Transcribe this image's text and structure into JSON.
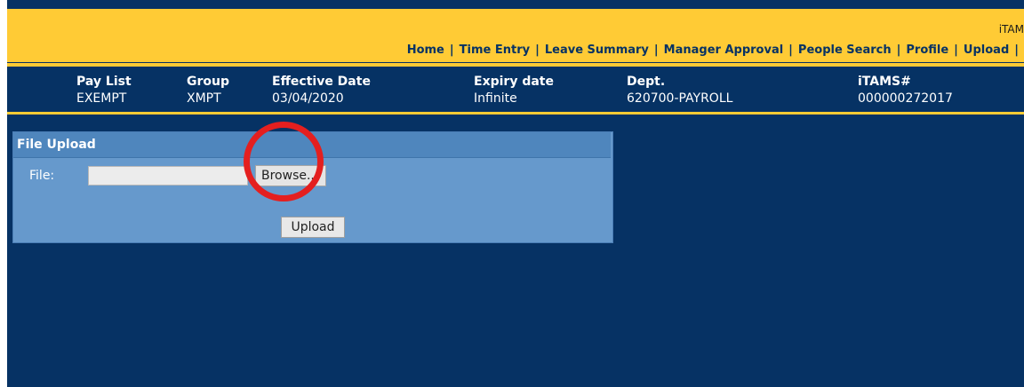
{
  "app": {
    "brand": "iTAM"
  },
  "nav": {
    "items": [
      "Home",
      "Time Entry",
      "Leave Summary",
      "Manager Approval",
      "People Search",
      "Profile",
      "Upload"
    ],
    "trailing_separator": "|"
  },
  "info": {
    "pay_list": {
      "label": "Pay List",
      "value": "EXEMPT"
    },
    "group": {
      "label": "Group",
      "value": "XMPT"
    },
    "effective_date": {
      "label": "Effective Date",
      "value": "03/04/2020"
    },
    "expiry_date": {
      "label": "Expiry date",
      "value": "Infinite"
    },
    "dept": {
      "label": "Dept.",
      "value": "620700-PAYROLL"
    },
    "itams": {
      "label": "iTAMS#",
      "value": "000000272017"
    }
  },
  "upload_panel": {
    "title": "File Upload",
    "file_label": "File:",
    "file_value": "",
    "browse_label": "Browse...",
    "upload_label": "Upload"
  },
  "colors": {
    "header_yellow": "#ffcb35",
    "page_navy": "#063264",
    "panel_blue": "#6699cc",
    "highlight_red": "#e41f1f"
  }
}
